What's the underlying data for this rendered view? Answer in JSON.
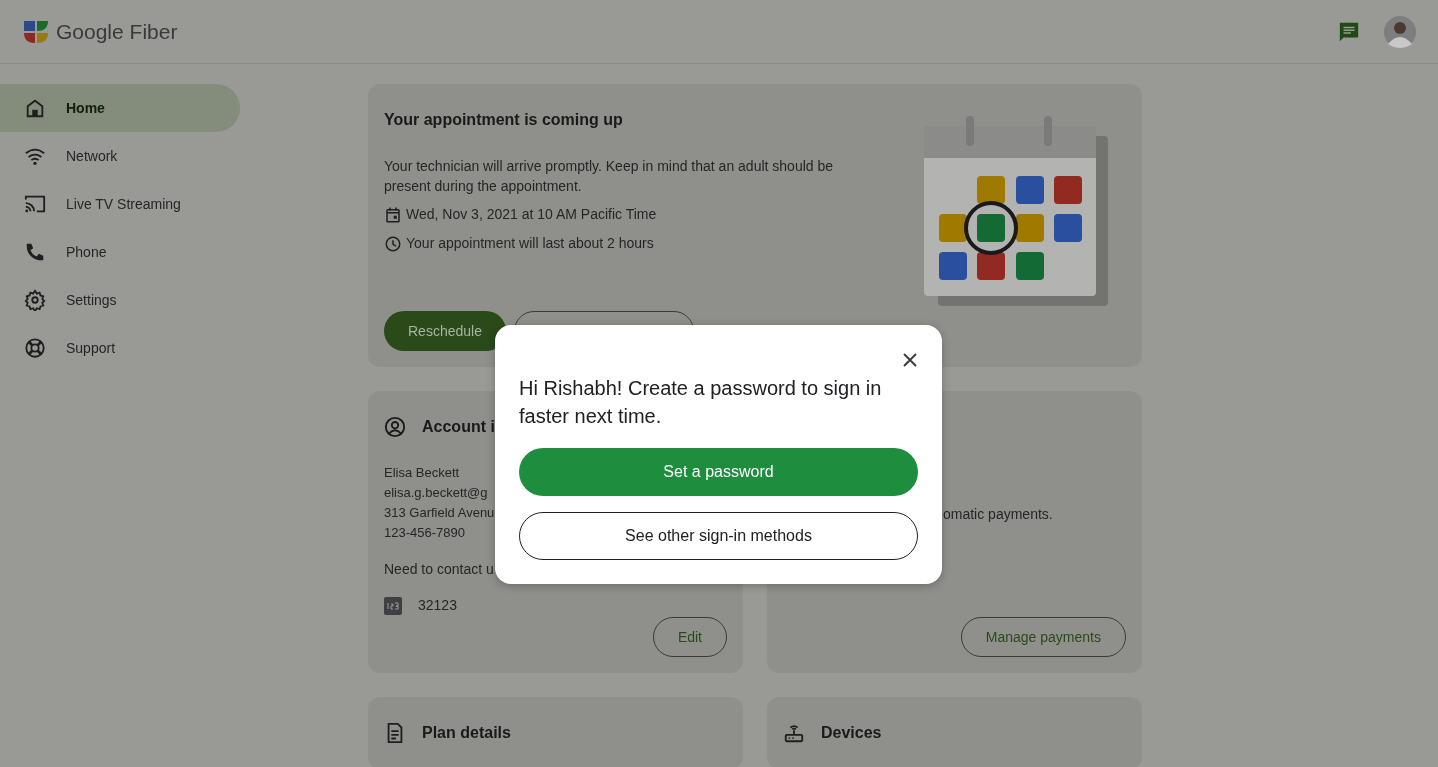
{
  "header": {
    "brand": "Google Fiber"
  },
  "sidebar": {
    "items": [
      {
        "label": "Home",
        "kind": "home",
        "selected": true
      },
      {
        "label": "Network",
        "kind": "network",
        "selected": false
      },
      {
        "label": "Live TV Streaming",
        "kind": "cast",
        "selected": false
      },
      {
        "label": "Phone",
        "kind": "phone",
        "selected": false
      },
      {
        "label": "Settings",
        "kind": "settings",
        "selected": false
      },
      {
        "label": "Support",
        "kind": "support",
        "selected": false
      }
    ]
  },
  "appointment_card": {
    "title": "Your appointment is coming up",
    "description": "Your technician will arrive promptly. Keep in mind that an adult should be present during the appointment.",
    "details": [
      {
        "kind": "date",
        "text": "Wed, Nov 3, 2021 at 10 AM Pacific Time"
      },
      {
        "kind": "duration",
        "text": "Your appointment will last about 2 hours"
      }
    ],
    "buttons": [
      {
        "kind": "filled",
        "label": "Reschedule"
      },
      {
        "kind": "outline"
      }
    ]
  },
  "account_card": {
    "title": "Account i",
    "lines": [
      "Elisa Beckett",
      "elisa.g.beckett@g",
      "313 Garfield Avenu",
      "123-456-7890"
    ],
    "contact_text": "Need to contact u",
    "pin": "32123",
    "button": "Edit"
  },
  "payments_card": {
    "text": "omatic payments.",
    "button": "Manage payments"
  },
  "bottom_cards": [
    {
      "kind": "plan",
      "title": "Plan details"
    },
    {
      "kind": "devices",
      "title": "Devices"
    }
  ],
  "dialog": {
    "message": "Hi Rishabh! Create a password to sign in faster next time.",
    "primary_button": "Set a password",
    "secondary_button": "See other sign-in methods"
  }
}
